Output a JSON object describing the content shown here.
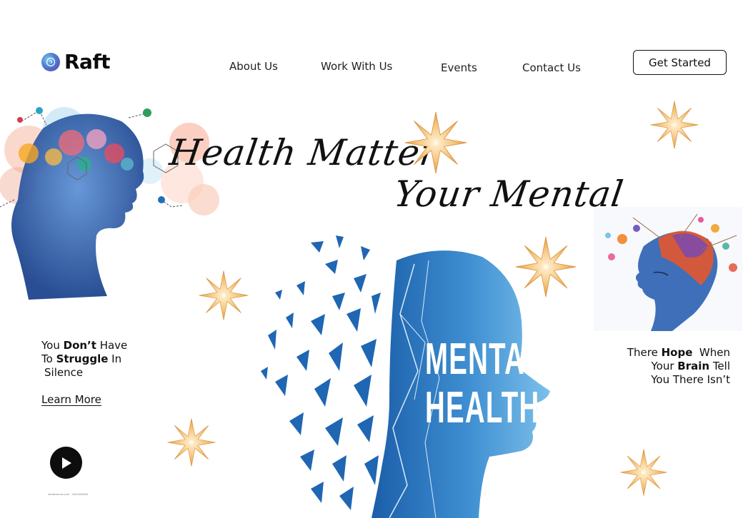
{
  "header": {
    "brand": "Raft",
    "nav": [
      "About Us",
      "Work With Us",
      "Events",
      "Contact Us"
    ],
    "cta": "Get Started"
  },
  "hero": {
    "headline_line1": "Health Matter",
    "headline_line2": "Your Mental",
    "center_image_text_line1": "MENTAL",
    "center_image_text_line2": "HEALTH"
  },
  "left_panel": {
    "t1": "You ",
    "t1_bold": "Don’t",
    "t2": " Have",
    "t3": "To ",
    "t3_bold": "Struggle",
    "t4": " In",
    "t5": "Silence",
    "learn_more": "Learn More",
    "credit": "shutterstock.com · 2464399805"
  },
  "right_panel": {
    "r1": "There ",
    "r1_bold": "Hope",
    "r2": "  When",
    "r3": "Your ",
    "r3_bold": "Brain",
    "r4": " Tell",
    "r5": "You There Isn’t"
  },
  "colors": {
    "accent_blue": "#1f66b3",
    "light_blue": "#5aa9dd",
    "star_gold": "#f0b35a",
    "text": "#111111"
  },
  "icons": {
    "brand": "brain-logo-icon",
    "play": "play-icon",
    "decor": "star-icon"
  }
}
